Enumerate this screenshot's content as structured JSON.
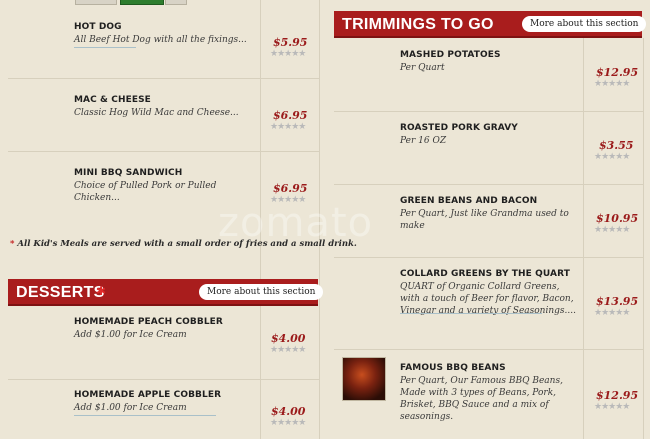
{
  "kids_items": [
    {
      "name": "HOT DOG",
      "desc": "All Beef Hot Dog with all the fixings...",
      "price": "$5.95"
    },
    {
      "name": "MAC & CHEESE",
      "desc": "Classic Hog Wild Mac and Cheese...",
      "price": "$6.95"
    },
    {
      "name": "MINI BBQ SANDWICH",
      "desc": "Choice of Pulled Pork or Pulled Chicken...",
      "price": "$6.95"
    }
  ],
  "kids_note": {
    "star": "*",
    "text": "All Kid's Meals are served with a small order of fries and a small drink."
  },
  "desserts": {
    "title": "DESSERTS",
    "more_label": "More about this section",
    "items": [
      {
        "name": "HOMEMADE PEACH COBBLER",
        "desc": "Add $1.00 for Ice Cream",
        "price": "$4.00"
      },
      {
        "name": "HOMEMADE APPLE COBBLER",
        "desc": "Add $1.00 for Ice Cream",
        "price": "$4.00"
      }
    ]
  },
  "trimmings": {
    "title": "TRIMMINGS TO GO",
    "more_label": "More about this section",
    "items": [
      {
        "name": "MASHED POTATOES",
        "desc": "Per Quart",
        "price": "$12.95"
      },
      {
        "name": "ROASTED PORK GRAVY",
        "desc": "Per 16 OZ",
        "price": "$3.55"
      },
      {
        "name": "GREEN BEANS AND BACON",
        "desc": "Per Quart, Just like Grandma used to make",
        "price": "$10.95"
      },
      {
        "name": "COLLARD GREENS BY THE QUART",
        "desc": "QUART of Organic Collard Greens, with a touch of Beer for flavor, Bacon, Vinegar and a variety of Seasonings....",
        "price": "$13.95"
      },
      {
        "name": "FAMOUS BBQ BEANS",
        "desc": "Per Quart, Our Famous  BBQ Beans, Made with 3 types of Beans, Pork, Brisket, BBQ Sauce and a mix of seasonings.",
        "price": "$12.95"
      }
    ]
  },
  "rating_stars": "★★★★★",
  "watermark": "zomato",
  "colors": {
    "accent_red": "#a91d1d",
    "price_red": "#9b1b1b",
    "background": "#ece6d6"
  }
}
